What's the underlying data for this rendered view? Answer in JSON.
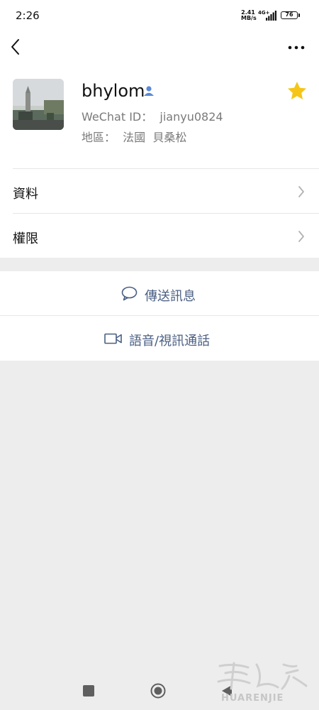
{
  "status_bar": {
    "time": "2:26",
    "net_speed_value": "2.41",
    "net_speed_unit": "MB/s",
    "network_type": "4G+",
    "battery": "76",
    "signal_icon": "signal-icon"
  },
  "nav": {
    "back_icon": "back-icon",
    "more_icon": "more-icon"
  },
  "profile": {
    "name": "bhylom",
    "wechat_id_line": "WeChat ID：  jianyu0824",
    "region_line": "地區：  法國  貝桑松",
    "starred": true,
    "colors": {
      "star": "#f5c518",
      "contact_icon": "#5b8ad6"
    }
  },
  "menu": {
    "items": [
      {
        "label": "資料"
      },
      {
        "label": "權限"
      }
    ]
  },
  "actions": {
    "send_message": "傳送訊息",
    "voice_video_call": "語音/視訊通話",
    "color": "#4a5f83"
  },
  "watermark": {
    "text": "HUARENJIE"
  }
}
